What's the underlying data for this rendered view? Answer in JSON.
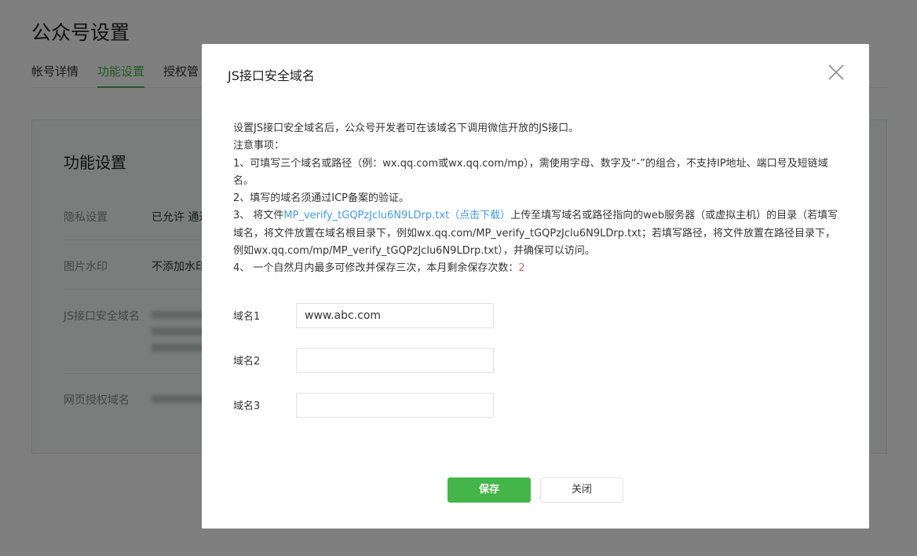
{
  "background": {
    "page_title": "公众号设置",
    "tabs": [
      {
        "label": "帐号详情"
      },
      {
        "label": "功能设置"
      },
      {
        "label": "授权管"
      }
    ],
    "card_title": "功能设置",
    "rows": [
      {
        "label": "隐私设置",
        "value": "已允许 通过"
      },
      {
        "label": "图片水印",
        "value": "不添加水印"
      },
      {
        "label": "JS接口安全域名",
        "value": ""
      },
      {
        "label": "网页授权域名",
        "value": ""
      }
    ]
  },
  "dialog": {
    "title": "JS接口安全域名",
    "close_icon": "close-icon",
    "notes": {
      "intro": "设置JS接口安全域名后，公众号开发者可在该域名下调用微信开放的JS接口。",
      "heading": "注意事项：",
      "item1": "1、可填写三个域名或路径（例：wx.qq.com或wx.qq.com/mp），需使用字母、数字及“-”的组合，不支持IP地址、端口号及短链域名。",
      "item2": "2、填写的域名须通过ICP备案的验证。",
      "item3_prefix": "3、 将文件",
      "item3_link": "MP_verify_tGQPzJclu6N9LDrp.txt（点击下载）",
      "item3_suffix": "上传至填写域名或路径指向的web服务器（或虚拟主机）的目录（若填写域名，将文件放置在域名根目录下，例如wx.qq.com/MP_verify_tGQPzJclu6N9LDrp.txt；若填写路径，将文件放置在路径目录下，例如wx.qq.com/mp/MP_verify_tGQPzJclu6N9LDrp.txt），并确保可以访问。",
      "item4_prefix": "4、 一个自然月内最多可修改并保存三次，本月剩余保存次数：",
      "item4_count": "2"
    },
    "fields": [
      {
        "label": "域名1",
        "value": "www.abc.com"
      },
      {
        "label": "域名2",
        "value": ""
      },
      {
        "label": "域名3",
        "value": ""
      }
    ],
    "save_label": "保存",
    "close_label": "关闭"
  },
  "colors": {
    "accent": "#44b549",
    "link": "#459ae9",
    "warning": "#e15f63"
  }
}
